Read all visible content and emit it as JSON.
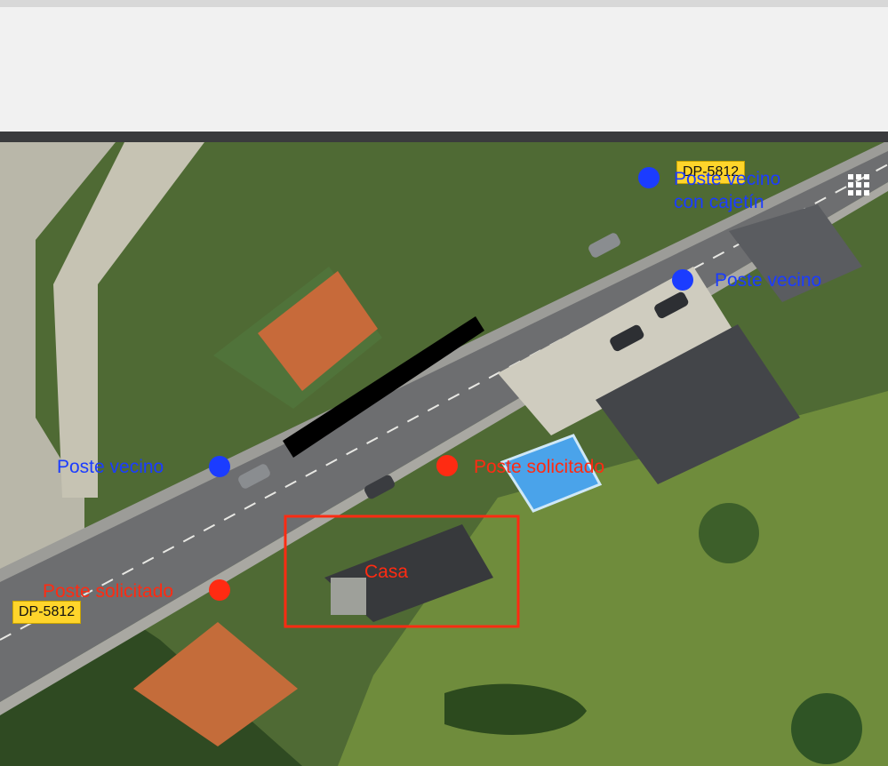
{
  "map": {
    "labels": {
      "poste_vecino_cajetin": "Poste vecino\ncon cajetín",
      "poste_vecino_right": "Poste vecino",
      "poste_vecino_left": "Poste vecino",
      "poste_solicitado_center": "Poste solicitado",
      "poste_solicitado_left": "Poste solicitado",
      "casa": "Casa"
    },
    "road_tags": {
      "top": "DP-5812",
      "bottom": "DP-5812"
    },
    "colors": {
      "neighbor_pole": "#1b3cff",
      "requested_pole": "#ff2b12",
      "road_tag": "#ffd52b"
    },
    "grid_button_icon": "grid-icon"
  }
}
